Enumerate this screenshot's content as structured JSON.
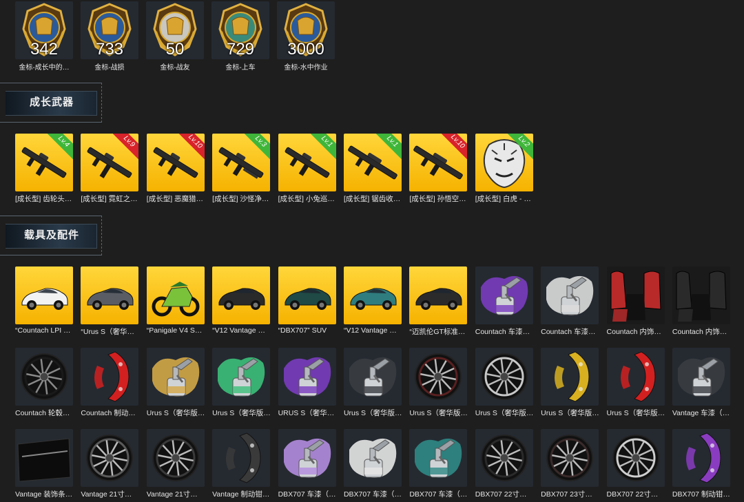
{
  "badges": [
    {
      "count": "342",
      "label": "金标-成长中的…",
      "icon": "trophy-medal-icon"
    },
    {
      "count": "733",
      "label": "金标-战损",
      "icon": "soldier-medal-icon"
    },
    {
      "count": "50",
      "label": "金标-战友",
      "icon": "dove-wreath-medal-icon"
    },
    {
      "count": "729",
      "label": "金标-上车",
      "icon": "car-medal-icon"
    },
    {
      "count": "3000",
      "label": "金标-水中作业",
      "icon": "seal-medal-icon"
    }
  ],
  "sections": {
    "weapons": "成长武器",
    "vehicles": "载具及配件"
  },
  "weapons": [
    {
      "label": "[成长型] 齿轮头…",
      "level": "Lv.4",
      "level_color": "green",
      "icon": "rifle-icon"
    },
    {
      "label": "[成长型] 霓虹之…",
      "level": "Lv.9",
      "level_color": "red",
      "icon": "smg-icon"
    },
    {
      "label": "[成长型] 恶魔猎…",
      "level": "Lv.10",
      "level_color": "red",
      "icon": "rifle-icon"
    },
    {
      "label": "[成长型] 沙怪净…",
      "level": "Lv.3",
      "level_color": "green",
      "icon": "shotgun-icon"
    },
    {
      "label": "[成长型] 小兔巡…",
      "level": "Lv.1",
      "level_color": "green",
      "icon": "rifle-icon"
    },
    {
      "label": "[成长型] 锯齿收…",
      "level": "Lv.1",
      "level_color": "green",
      "icon": "sniper-icon"
    },
    {
      "label": "[成长型] 孙悟空…",
      "level": "Lv.10",
      "level_color": "red",
      "icon": "sniper-icon"
    },
    {
      "label": "[成长型] 白虎 - …",
      "level": "Lv.2",
      "level_color": "green",
      "icon": "tiger-mask-icon"
    }
  ],
  "vehicles_row1": [
    {
      "label": "“Countach LPI …",
      "tile": "gold",
      "icon": "car-icon",
      "color": "#f2f2f2"
    },
    {
      "label": "“Urus S（奢华…",
      "tile": "gold",
      "icon": "car-icon",
      "color": "#5a5e64"
    },
    {
      "label": "“Panigale V4 S…",
      "tile": "gold",
      "icon": "motorcycle-icon",
      "color": "#7ac23a"
    },
    {
      "label": "“V12 Vantage …",
      "tile": "gold",
      "icon": "car-icon",
      "color": "#2a2a2a"
    },
    {
      "label": "“DBX707” SUV",
      "tile": "gold",
      "icon": "car-icon",
      "color": "#1f4a45"
    },
    {
      "label": "“V12 Vantage …",
      "tile": "gold",
      "icon": "car-icon",
      "color": "#2f7d7e"
    },
    {
      "label": "“迈凯伦GT标准…",
      "tile": "gold",
      "icon": "car-icon",
      "color": "#2b2b2b"
    },
    {
      "label": "Countach 车漆…",
      "tile": "dark",
      "icon": "paint-spray-icon",
      "color": "#7a3cc0"
    },
    {
      "label": "Countach 车漆…",
      "tile": "dark",
      "icon": "paint-spray-icon",
      "color": "#dcdcdc"
    },
    {
      "label": "Countach 内饰…",
      "tile": "dark",
      "icon": "car-seat-icon",
      "color": "#b82a2a"
    },
    {
      "label": "Countach 内饰…",
      "tile": "dark",
      "icon": "car-seat-icon",
      "color": "#2a2a2a"
    }
  ],
  "vehicles_row2": [
    {
      "label": "Countach 轮毂…",
      "tile": "dark",
      "icon": "wheel-icon",
      "color": "#1a1a1a"
    },
    {
      "label": "Countach 制动…",
      "tile": "dark",
      "icon": "brake-caliper-icon",
      "color": "#d22020"
    },
    {
      "label": "Urus S（奢华版…",
      "tile": "dark",
      "icon": "paint-spray-icon",
      "color": "#d4a847"
    },
    {
      "label": "Urus S（奢华版…",
      "tile": "dark",
      "icon": "paint-spray-icon",
      "color": "#3cc07a"
    },
    {
      "label": "URUS S（奢华…",
      "tile": "dark",
      "icon": "paint-spray-icon",
      "color": "#7a3cc0"
    },
    {
      "label": "Urus S（奢华版…",
      "tile": "dark",
      "icon": "paint-spray-icon",
      "color": "#3a3d42"
    },
    {
      "label": "Urus S（奢华版…",
      "tile": "dark",
      "icon": "wheel-icon",
      "color": "#5a2020"
    },
    {
      "label": "Urus S（奢华版…",
      "tile": "dark",
      "icon": "wheel-icon",
      "color": "#c8c8c8"
    },
    {
      "label": "Urus S（奢华版…",
      "tile": "dark",
      "icon": "brake-caliper-icon",
      "color": "#d8b020"
    },
    {
      "label": "Urus S（奢华版…",
      "tile": "dark",
      "icon": "brake-caliper-icon",
      "color": "#d22020"
    },
    {
      "label": "Vantage 车漆（…",
      "tile": "dark",
      "icon": "paint-spray-icon",
      "color": "#3a3d42"
    }
  ],
  "vehicles_row3": [
    {
      "label": "Vantage 装饰条…",
      "tile": "dark",
      "icon": "trim-strip-icon",
      "color": "#111111"
    },
    {
      "label": "Vantage 21寸…",
      "tile": "dark",
      "icon": "wheel-icon",
      "color": "#5a5a5a"
    },
    {
      "label": "Vantage 21寸…",
      "tile": "dark",
      "icon": "wheel-icon",
      "color": "#3a3a3a"
    },
    {
      "label": "Vantage 制动钳…",
      "tile": "dark",
      "icon": "brake-caliper-icon",
      "color": "#3a3a3a"
    },
    {
      "label": "DBX707 车漆（…",
      "tile": "dark",
      "icon": "paint-spray-icon",
      "color": "#b48ce0"
    },
    {
      "label": "DBX707 车漆（…",
      "tile": "dark",
      "icon": "paint-spray-icon",
      "color": "#e6e6e6"
    },
    {
      "label": "DBX707 车漆（…",
      "tile": "dark",
      "icon": "paint-spray-icon",
      "color": "#2f8a86"
    },
    {
      "label": "DBX707 22寸…",
      "tile": "dark",
      "icon": "wheel-icon",
      "color": "#2a2a2a"
    },
    {
      "label": "DBX707 23寸…",
      "tile": "dark",
      "icon": "wheel-icon",
      "color": "#3a2a2a"
    },
    {
      "label": "DBX707 22寸…",
      "tile": "dark",
      "icon": "wheel-icon",
      "color": "#cfcfcf"
    },
    {
      "label": "DBX707 制动钳…",
      "tile": "dark",
      "icon": "brake-caliper-icon",
      "color": "#8a3cc0"
    }
  ]
}
